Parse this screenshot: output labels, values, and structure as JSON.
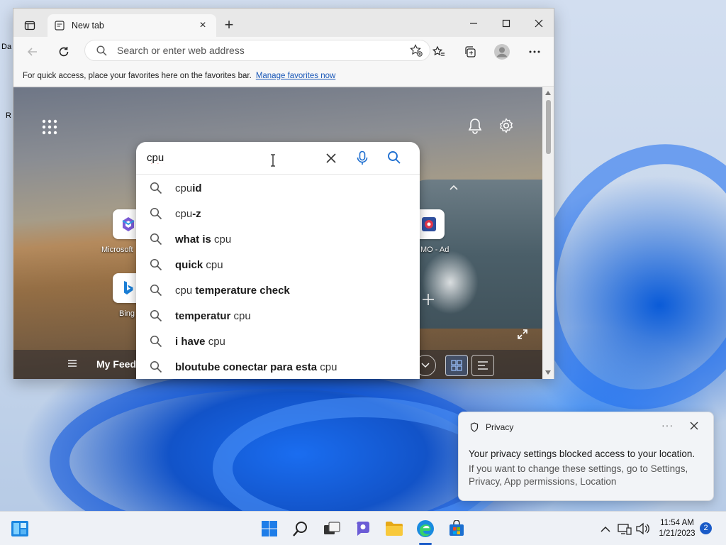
{
  "desktop": {
    "label_da": "Da",
    "label_r": "R"
  },
  "browser": {
    "tab": {
      "title": "New tab"
    },
    "address": {
      "placeholder": "Search or enter web address"
    },
    "favbar": {
      "message": "For quick access, place your favorites here on the favorites bar.",
      "link": "Manage favorites now"
    }
  },
  "newtab_page": {
    "tiles": [
      {
        "label": "Microsoft"
      },
      {
        "label": "MO - Ad"
      },
      {
        "label": "Bing"
      }
    ],
    "feed": {
      "title": "My Feed"
    }
  },
  "search": {
    "query": "cpu",
    "suggestions": [
      {
        "pre": "cpu",
        "bold": "id",
        "post": ""
      },
      {
        "pre": "cpu",
        "bold": "-z",
        "post": ""
      },
      {
        "pre": "",
        "bold": "what is",
        "post": " cpu"
      },
      {
        "pre": "",
        "bold": "quick",
        "post": " cpu"
      },
      {
        "pre": "cpu ",
        "bold": "temperature check",
        "post": ""
      },
      {
        "pre": "",
        "bold": "temperatur",
        "post": " cpu"
      },
      {
        "pre": "",
        "bold": "i have",
        "post": " cpu"
      },
      {
        "pre": "",
        "bold": "bloutube conectar para esta",
        "post": " cpu"
      }
    ]
  },
  "toast": {
    "title": "Privacy",
    "more": "···",
    "message": "Your privacy settings blocked access to your location.",
    "detail": "If you want to change these settings, go to Settings, Privacy, App permissions, Location"
  },
  "taskbar": {
    "time": "11:54 AM",
    "date": "1/21/2023",
    "notification_count": "2"
  },
  "colors": {
    "accent": "#1a5bc8",
    "link": "#1a58b8",
    "search_icon": "#1f6fd0"
  }
}
